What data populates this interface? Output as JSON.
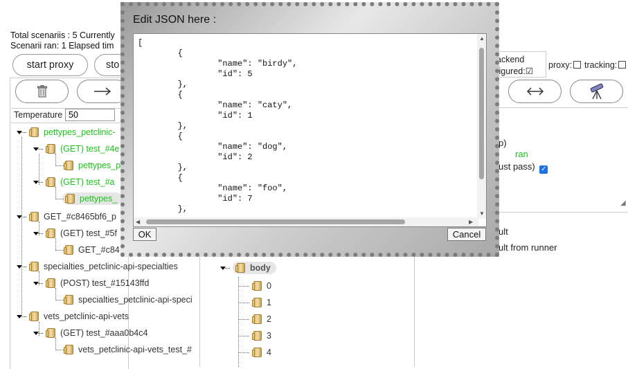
{
  "status": {
    "line1": "Total scenariis : 5 Currently",
    "line2": "Scenarii ran: 1   Elapsed tim"
  },
  "toolbar": {
    "start_proxy": "start proxy",
    "stop_partial": "sto",
    "backend_line1": "ackend",
    "backend_line2": "figured:",
    "backend_check": "☑",
    "proxy_label": "proxy:",
    "tracking_label": "tracking:"
  },
  "temperature": {
    "label": "Temperature",
    "value": "50"
  },
  "tree": {
    "rows": [
      {
        "label": "pettypes_petclinic-",
        "color": "green"
      },
      {
        "label": "(GET) test_#4e",
        "color": "green"
      },
      {
        "label": "pettypes_p",
        "color": "green"
      },
      {
        "label": "(GET) test_#a",
        "color": "green"
      },
      {
        "label": "pettypes_",
        "color": "green"
      },
      {
        "label": "GET_#c8465bf6_p",
        "color": "normal"
      },
      {
        "label": "(GET) test_#5f",
        "color": "normal"
      },
      {
        "label": "GET_#c84",
        "color": "normal"
      },
      {
        "label": "specialties_petclinic-api-specialties",
        "color": "normal"
      },
      {
        "label": "(POST) test_#15143ffd",
        "color": "normal"
      },
      {
        "label": "specialties_petclinic-api-speci",
        "color": "normal"
      },
      {
        "label": "vets_petclinic-api-vets",
        "color": "normal"
      },
      {
        "label": "(GET) test_#aaa0b4c4",
        "color": "normal"
      },
      {
        "label": "vets_petclinic-api-vets_test_#",
        "color": "normal"
      }
    ]
  },
  "body_tree": {
    "root": "body",
    "items": [
      "0",
      "1",
      "2",
      "3",
      "4"
    ]
  },
  "right_panel": {
    "p_frag": "p)",
    "ran": "ran",
    "must_pass": "ust pass)",
    "result": "ult",
    "result_runner": "ult from runner"
  },
  "modal": {
    "title": "Edit JSON here :",
    "json_text": "[\n        {\n                \"name\": \"birdy\",\n                \"id\": 5\n        },\n        {\n                \"name\": \"caty\",\n                \"id\": 1\n        },\n        {\n                \"name\": \"dog\",\n                \"id\": 2\n        },\n        {\n                \"name\": \"foo\",\n                \"id\": 7\n        },",
    "ok": "OK",
    "cancel": "Cancel"
  },
  "icons": {
    "trash": "trash-icon",
    "arrow_right": "arrow-right-icon",
    "arrow_both": "arrow-both-icon",
    "telescope": "telescope-icon"
  }
}
